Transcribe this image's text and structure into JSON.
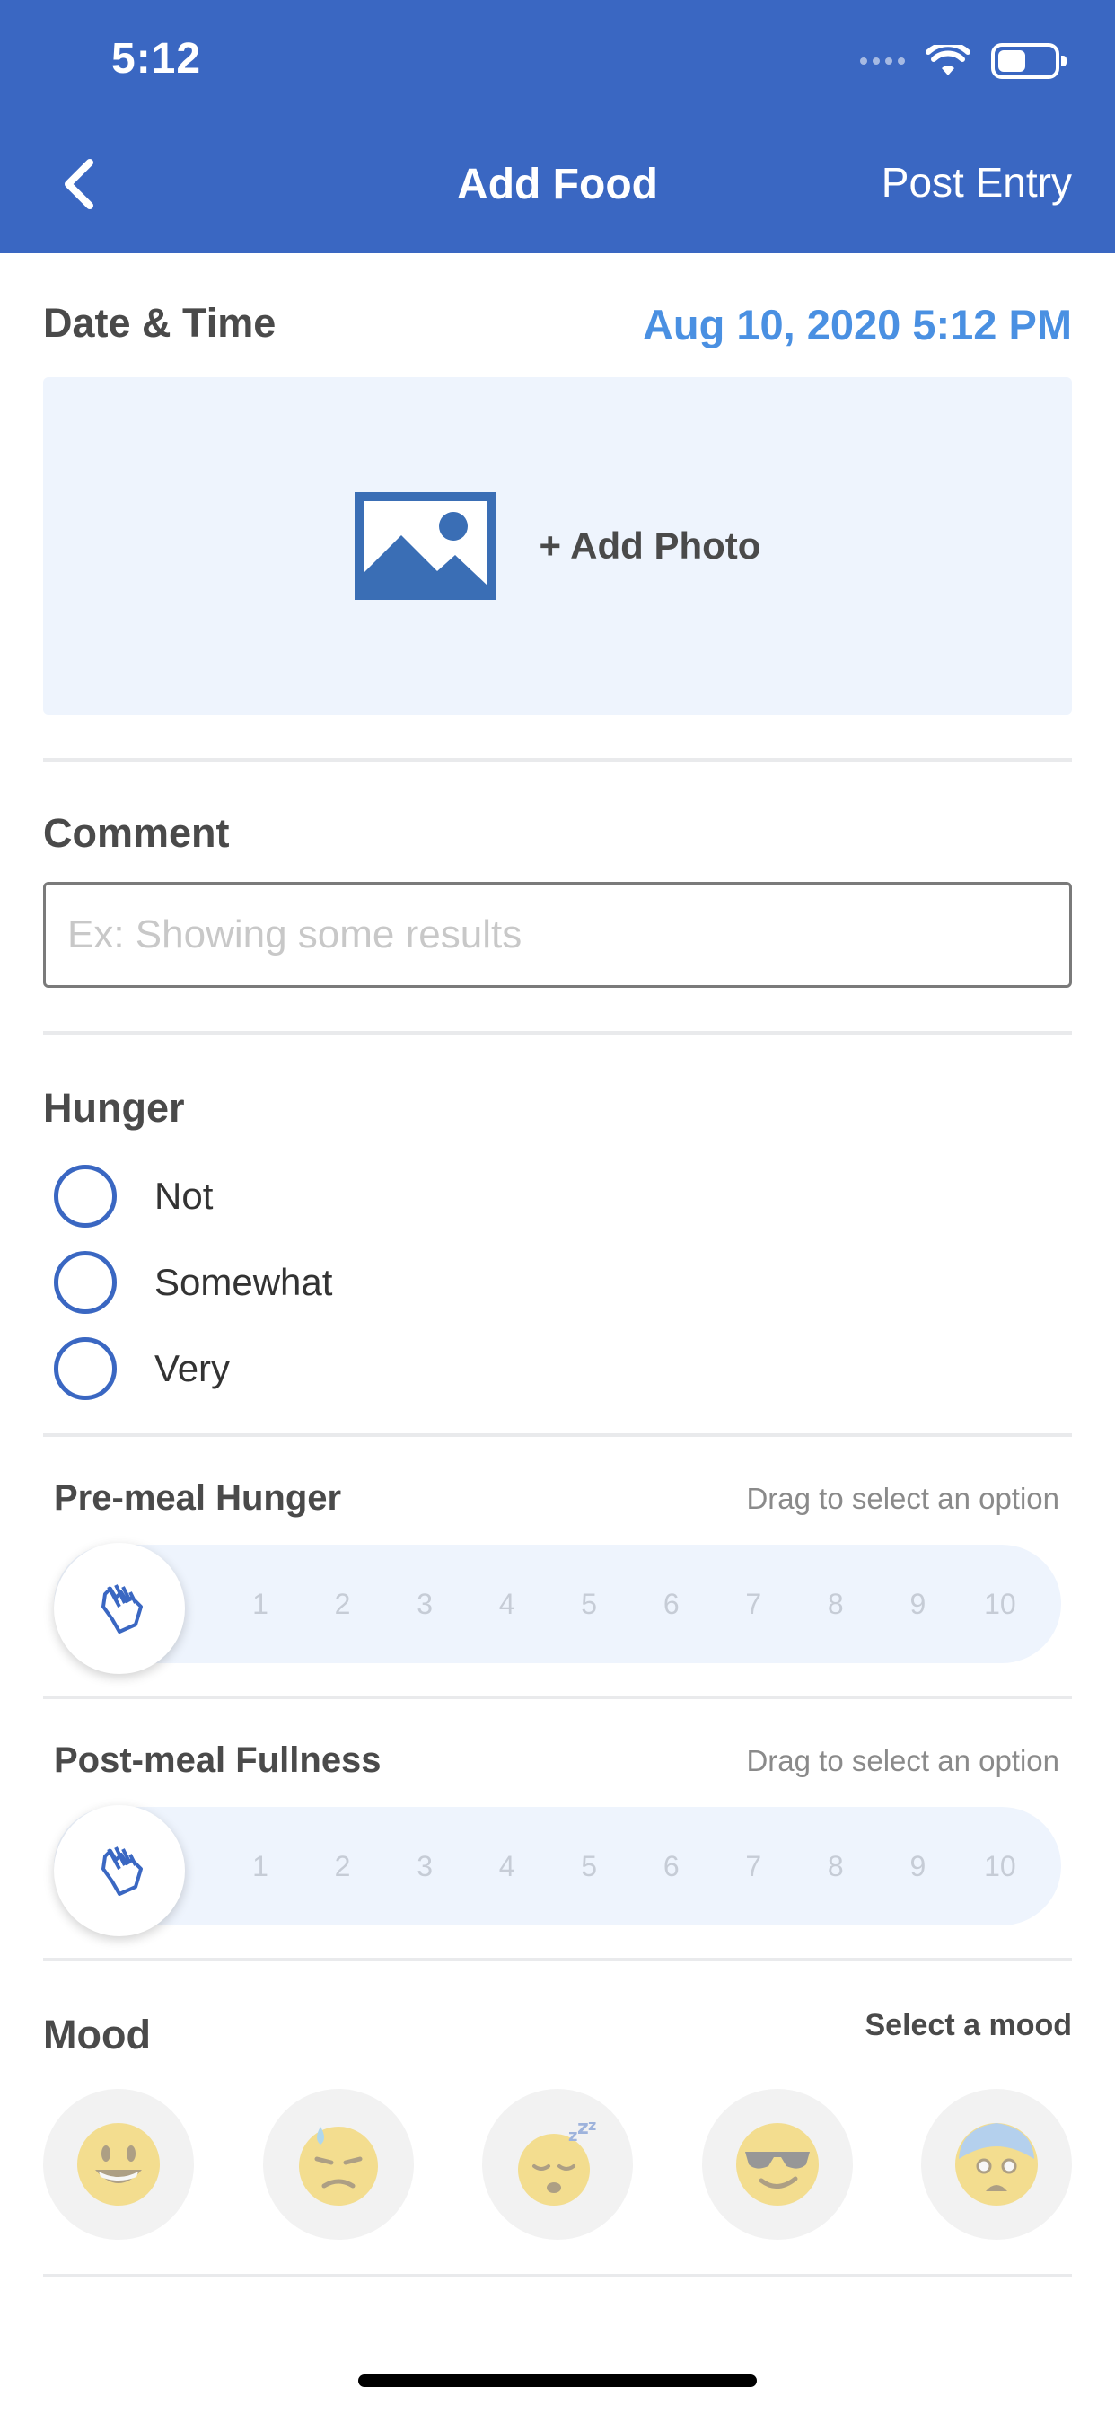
{
  "status_bar": {
    "time": "5:12"
  },
  "header": {
    "title": "Add Food",
    "post_label": "Post Entry"
  },
  "date_time": {
    "label": "Date & Time",
    "value": "Aug 10, 2020 5:12 PM"
  },
  "photo": {
    "label": "+ Add Photo"
  },
  "comment": {
    "label": "Comment",
    "placeholder": "Ex: Showing some results",
    "value": ""
  },
  "hunger": {
    "label": "Hunger",
    "options": [
      "Not",
      "Somewhat",
      "Very"
    ]
  },
  "pre_meal": {
    "label": "Pre-meal Hunger",
    "hint": "Drag to select an option",
    "scale": [
      "1",
      "2",
      "3",
      "4",
      "5",
      "6",
      "7",
      "8",
      "9",
      "10"
    ]
  },
  "post_meal": {
    "label": "Post-meal Fullness",
    "hint": "Drag to select an option",
    "scale": [
      "1",
      "2",
      "3",
      "4",
      "5",
      "6",
      "7",
      "8",
      "9",
      "10"
    ]
  },
  "mood": {
    "label": "Mood",
    "hint": "Select a mood",
    "options": [
      "smiling-face-icon",
      "sad-sweat-face-icon",
      "sleeping-face-icon",
      "sunglasses-face-icon",
      "anxious-face-icon"
    ]
  },
  "colors": {
    "header": "#3a67c2",
    "accent": "#4a90e2",
    "track": "#eef4fd"
  }
}
